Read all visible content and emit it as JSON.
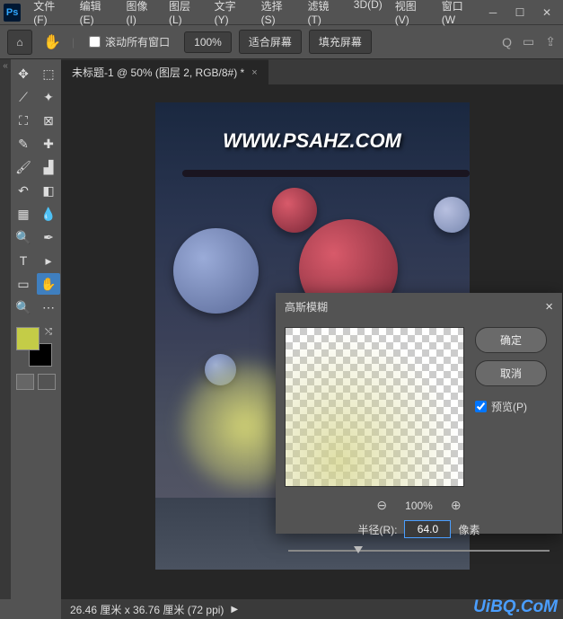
{
  "menu": {
    "file": "文件(F)",
    "edit": "编辑(E)",
    "image": "图像(I)",
    "layer": "图层(L)",
    "text": "文字(Y)",
    "select": "选择(S)",
    "filter": "滤镜(T)",
    "3d": "3D(D)",
    "view": "视图(V)",
    "window": "窗口(W"
  },
  "optbar": {
    "scroll_all": "滚动所有窗口",
    "zoom": "100%",
    "fit": "适合屏幕",
    "fill": "填充屏幕"
  },
  "tab": {
    "title": "未标题-1 @ 50% (图层 2, RGB/8#) *"
  },
  "watermark": "WWW.PSAHZ.COM",
  "dialog": {
    "title": "高斯模糊",
    "ok": "确定",
    "cancel": "取消",
    "preview": "预览(P)",
    "zoom": "100%",
    "radius_label": "半径(R):",
    "radius_value": "64.0",
    "radius_unit": "像素"
  },
  "status": {
    "dims": "26.46 厘米 x 36.76 厘米 (72 ppi)"
  },
  "site": "UiBQ.CoM",
  "colors": {
    "fg": "#c4cc47",
    "bg": "#000000"
  }
}
